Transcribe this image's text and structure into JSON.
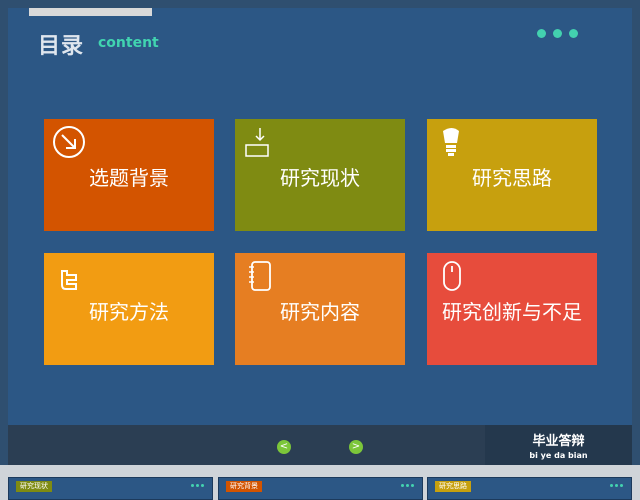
{
  "header": {
    "title_cn": "目录",
    "title_en": "content"
  },
  "tiles": [
    {
      "label": "选题背景",
      "icon": "arrow-circle-icon",
      "color": "#d35400"
    },
    {
      "label": "研究现状",
      "icon": "download-box-icon",
      "color": "#7f8b12"
    },
    {
      "label": "研究思路",
      "icon": "lightbulb-icon",
      "color": "#c7a00e"
    },
    {
      "label": "研究方法",
      "icon": "twitter-icon",
      "color": "#f29c12"
    },
    {
      "label": "研究内容",
      "icon": "notebook-icon",
      "color": "#e67e22"
    },
    {
      "label": "研究创新与不足",
      "icon": "mouse-icon",
      "color": "#e74c3c"
    }
  ],
  "footer": {
    "prev_symbol": "<",
    "next_symbol": ">",
    "brand_cn": "毕业答辩",
    "brand_pinyin": "bi  ye da bian"
  },
  "thumbnails": [
    {
      "label": "研究现状",
      "color": "#7f8b12"
    },
    {
      "label": "研究背景",
      "color": "#d35400"
    },
    {
      "label": "研究思路",
      "color": "#c7a00e"
    }
  ],
  "colors": {
    "background": "#2c5785",
    "accent": "#43d1af",
    "nav_button": "#7cc63a"
  }
}
